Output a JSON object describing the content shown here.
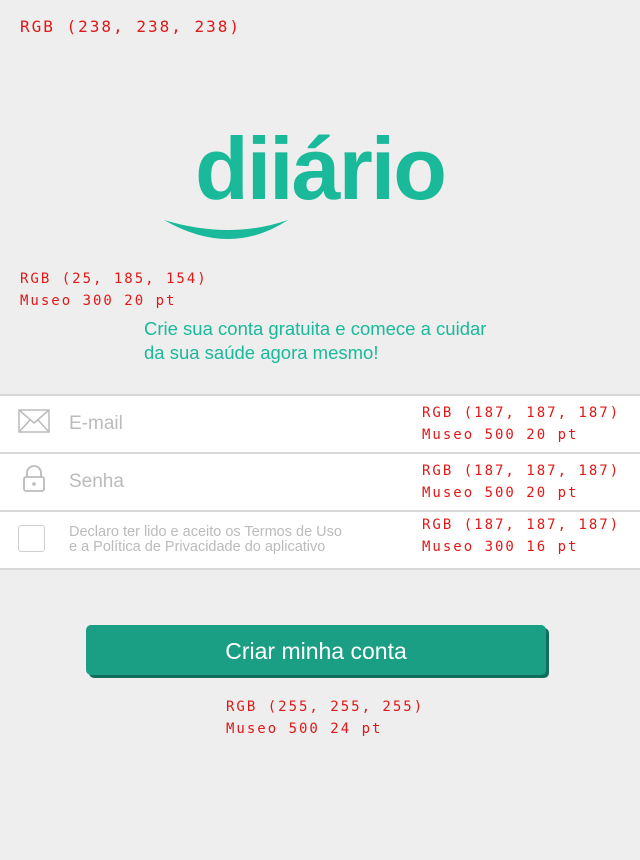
{
  "annotations": {
    "background": "RGB (238, 238, 238)",
    "tagline_color": "RGB (25, 185, 154)",
    "tagline_font": "Museo 300 20 pt",
    "email_color": "RGB (187, 187, 187)",
    "email_font": "Museo 500 20 pt",
    "password_color": "RGB (187, 187, 187)",
    "password_font": "Museo 500 20 pt",
    "terms_color": "RGB (187, 187, 187)",
    "terms_font": "Museo 300 16 pt",
    "button_color": "RGB (255, 255, 255)",
    "button_font": "Museo 500 24 pt"
  },
  "logo": {
    "text": "diiário",
    "color": "#19b99a"
  },
  "tagline": "Crie sua conta gratuita e comece a cuidar da sua saúde agora mesmo!",
  "form": {
    "email_placeholder": "E-mail",
    "password_placeholder": "Senha",
    "terms_line1": "Declaro ter lido e aceito os Termos de Uso",
    "terms_line2": "e a Política de Privacidade do aplicativo"
  },
  "cta": {
    "label": "Criar minha conta"
  },
  "icons": {
    "email": "envelope-icon",
    "password": "lock-icon",
    "terms": "checkbox-icon"
  },
  "colors": {
    "brand": "#19b99a",
    "button": "#1a9f84",
    "placeholder": "#bbbbbb",
    "background": "#eeeeee"
  }
}
